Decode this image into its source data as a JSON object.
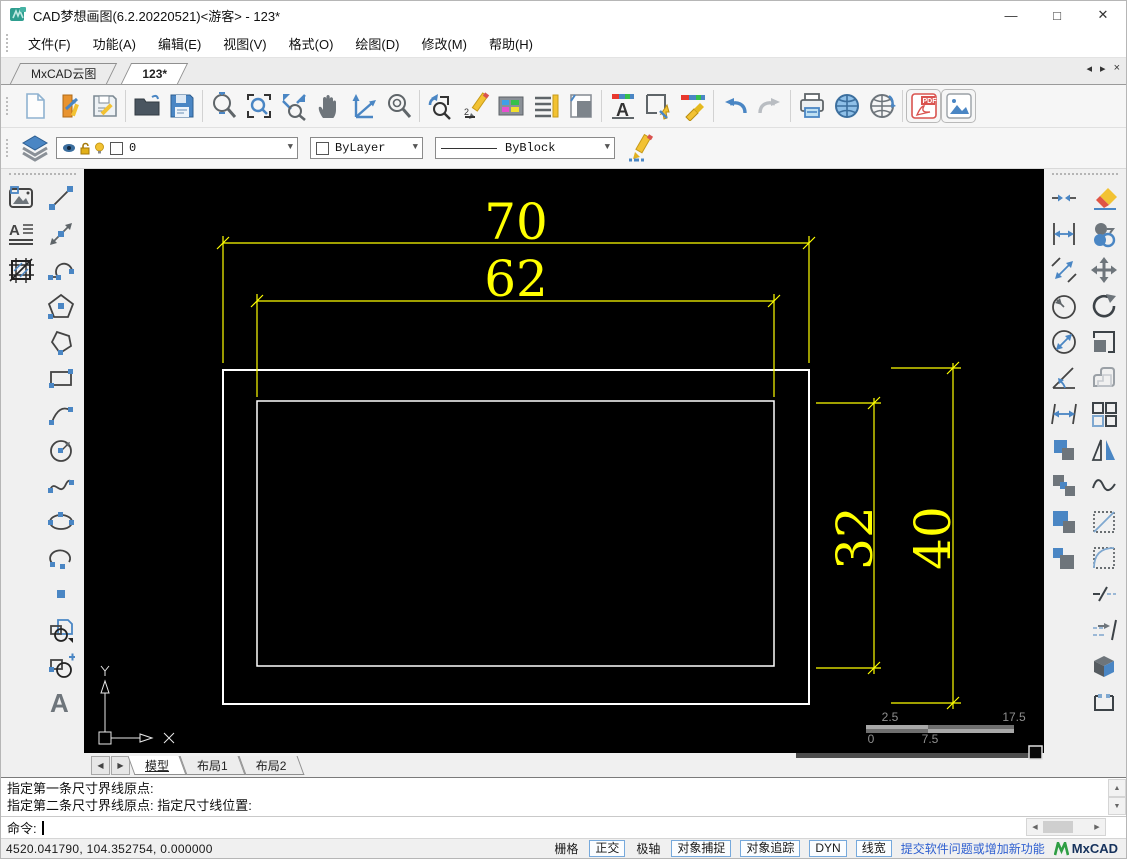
{
  "window": {
    "title": "CAD梦想画图(6.2.20220521)<游客> - 123*",
    "minimize": "—",
    "maximize": "□",
    "close": "✕"
  },
  "menubar": {
    "items": [
      "文件(F)",
      "功能(A)",
      "编辑(E)",
      "视图(V)",
      "格式(O)",
      "绘图(D)",
      "修改(M)",
      "帮助(H)"
    ]
  },
  "doc_tabs": {
    "tabs": [
      {
        "label": "MxCAD云图"
      },
      {
        "label": "123*"
      }
    ],
    "nav_prev": "◂",
    "nav_next": "▸",
    "nav_close": "×"
  },
  "toolbar": {
    "icons": [
      "new-file",
      "open-cloud",
      "save",
      "open-file",
      "save-as",
      "zoom-dynamic",
      "zoom-window",
      "zoom-extents",
      "pan",
      "measure",
      "zoom-center",
      "zoom-previous",
      "sketch",
      "color-palette",
      "linetype",
      "layout-page",
      "text-style",
      "select-object",
      "match-properties",
      "undo",
      "redo",
      "print",
      "web-publish",
      "web-sync",
      "export-pdf",
      "insert-image"
    ]
  },
  "properties_bar": {
    "layer_value": "0",
    "color_value": "ByLayer",
    "linetype_value": "ByBlock"
  },
  "left_toolbar": {
    "icons": [
      "insert-image",
      "text-style",
      "hatch",
      "line",
      "construction-line",
      "polyline",
      "polygon",
      "irregular-polygon",
      "rectangle",
      "arc",
      "circle",
      "spline",
      "ellipse",
      "elliptical-arc",
      "point",
      "insert-block",
      "create-block",
      "single-text"
    ]
  },
  "right_toolbar": {
    "dimension_icons": [
      "break-at-point",
      "linear-dimension",
      "aligned-dimension",
      "radius-dimension",
      "diameter-dimension",
      "angular-dimension",
      "continued-dimension",
      "copy-clip",
      "cut-clip",
      "paste-clip",
      "paste-block"
    ],
    "modify_icons": [
      "erase",
      "copy",
      "move",
      "rotate",
      "scale",
      "offset",
      "array",
      "mirror",
      "revision-cloud",
      "chamfer",
      "fillet",
      "break",
      "extend",
      "explode",
      "stretch"
    ]
  },
  "canvas": {
    "dimensions": {
      "d70": "70",
      "d62": "62",
      "d32": "32",
      "d40": "40"
    },
    "ucs": {
      "x": "X",
      "y": "Y"
    },
    "scale_bar": {
      "labels": [
        "2.5",
        "17.5",
        "0",
        "7.5"
      ]
    }
  },
  "layout_tabs": {
    "nav_prev": "◀",
    "nav_next": "▶",
    "items": [
      "模型",
      "布局1",
      "布局2"
    ]
  },
  "command": {
    "history": [
      "指定第一条尺寸界线原点:",
      "指定第二条尺寸界线原点:  指定尺寸线位置:"
    ],
    "prompt": "命令:"
  },
  "statusbar": {
    "coordinates": "4520.041790,  104.352754,  0.000000",
    "toggles": [
      "栅格",
      "正交",
      "极轴",
      "对象捕捉",
      "对象追踪",
      "DYN",
      "线宽"
    ],
    "link": "提交软件问题或增加新功能",
    "brand": "MxCAD"
  },
  "colors": {
    "canvas_bg": "#000000",
    "dimension": "#ffff00",
    "geometry": "#ffffff",
    "accent_blue": "#4a86c4",
    "toggle_border": "#76a9dc",
    "link": "#2e5fd0"
  }
}
